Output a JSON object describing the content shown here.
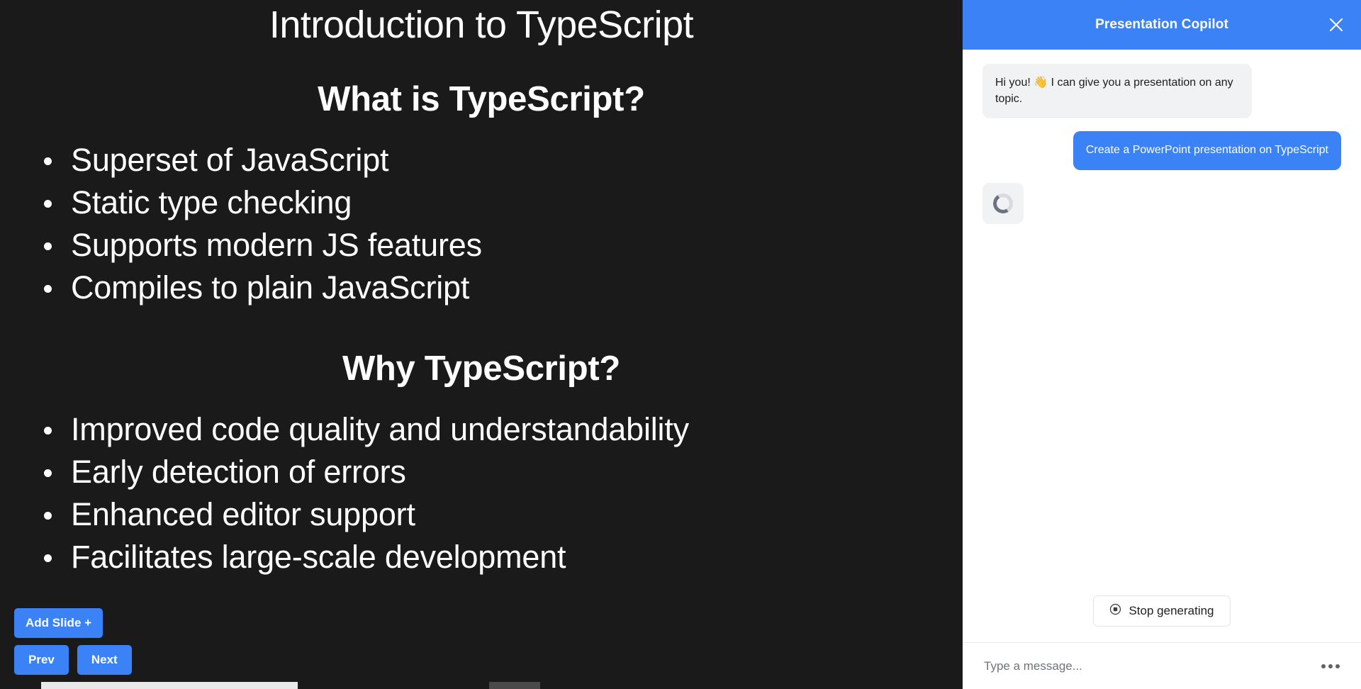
{
  "deck": {
    "slide": {
      "title": "Introduction to TypeScript",
      "sections": [
        {
          "heading": "What is TypeScript?",
          "bullets": [
            "Superset of JavaScript",
            "Static type checking",
            "Supports modern JS features",
            "Compiles to plain JavaScript"
          ]
        },
        {
          "heading": "Why TypeScript?",
          "bullets": [
            "Improved code quality and understandability",
            "Early detection of errors",
            "Enhanced editor support",
            "Facilitates large-scale development"
          ]
        }
      ]
    },
    "controls": {
      "add_slide_label": "Add Slide +",
      "prev_label": "Prev",
      "next_label": "Next"
    },
    "background_color": "#1a1a1a",
    "text_color": "#ffffff",
    "accent_color": "#3b82f6"
  },
  "copilot": {
    "title": "Presentation Copilot",
    "close_icon": "close-icon",
    "header_color": "#3b82f6",
    "messages": [
      {
        "role": "bot",
        "text": "Hi you! 👋 I can give you a presentation on any topic.",
        "kind": "text"
      },
      {
        "role": "user",
        "text": "Create a PowerPoint presentation on TypeScript",
        "kind": "text"
      },
      {
        "role": "bot",
        "text": "",
        "kind": "loading",
        "icon": "loading-spinner-icon"
      }
    ],
    "stop_button": {
      "label": "Stop generating",
      "icon": "stop-circle-icon"
    },
    "input": {
      "placeholder": "Type a message...",
      "value": "",
      "menu_icon": "kebab-menu-icon"
    }
  },
  "scrollbar": {
    "orientation": "horizontal",
    "thumb_color": "#e8e8e8",
    "track_color": "#1a1a1a"
  }
}
